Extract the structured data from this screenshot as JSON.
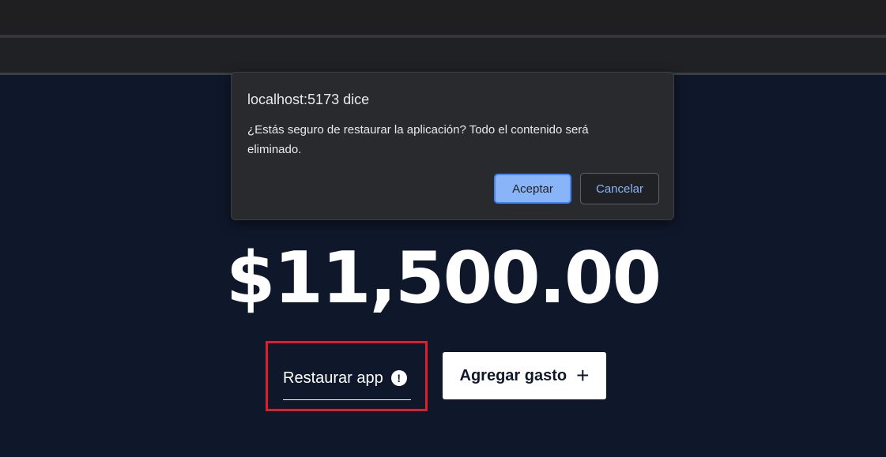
{
  "app": {
    "budget_amount": "$11,500.00",
    "restore_button_label": "Restaurar app",
    "restore_icon": "!",
    "add_expense_label": "Agregar gasto",
    "add_icon": "+"
  },
  "dialog": {
    "title": "localhost:5173 dice",
    "message": "¿Estás seguro de restaurar la aplicación? Todo el contenido será eliminado.",
    "accept_label": "Aceptar",
    "cancel_label": "Cancelar"
  },
  "colors": {
    "app_background": "#0f172a",
    "dialog_background": "#292a2d",
    "accept_button": "#8ab4f8",
    "highlight_box": "#e01e2b"
  }
}
